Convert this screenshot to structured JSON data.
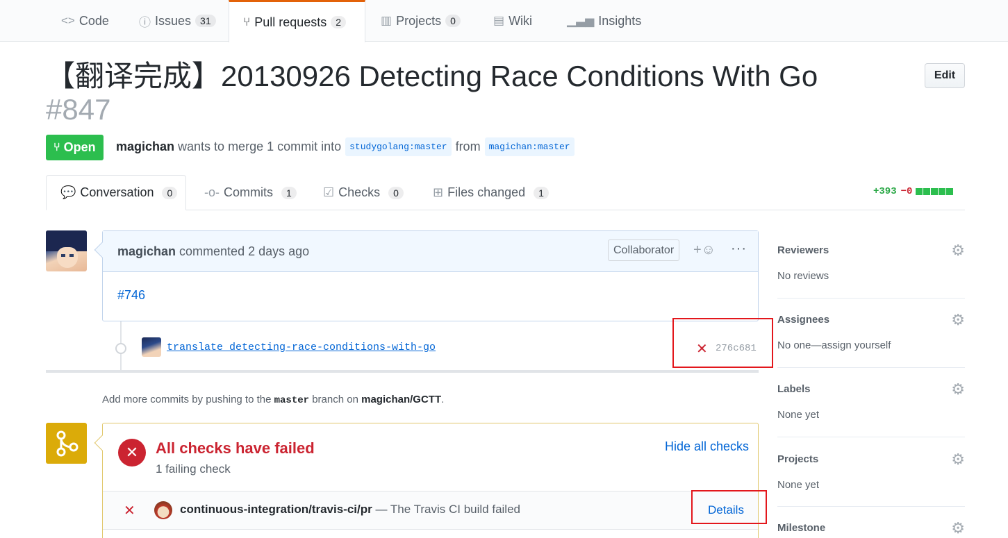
{
  "reponav": {
    "tabs": [
      {
        "label": "Code",
        "icon": "code-icon",
        "count": null
      },
      {
        "label": "Issues",
        "icon": "issue-icon",
        "count": "31"
      },
      {
        "label": "Pull requests",
        "icon": "pull-request-icon",
        "count": "2"
      },
      {
        "label": "Projects",
        "icon": "project-icon",
        "count": "0"
      },
      {
        "label": "Wiki",
        "icon": "book-icon",
        "count": null
      },
      {
        "label": "Insights",
        "icon": "graph-icon",
        "count": null
      }
    ],
    "selected": "Pull requests"
  },
  "pr": {
    "title": "【翻译完成】20130926 Detecting Race Conditions With Go",
    "number": "#847",
    "edit_label": "Edit",
    "state": "Open",
    "author": "magichan",
    "merge_text": "wants to merge 1 commit into",
    "base_branch": "studygolang:master",
    "from_text": "from",
    "head_branch": "magichan:master"
  },
  "prtabs": [
    {
      "label": "Conversation",
      "icon": "comment-discussion-icon",
      "count": "0"
    },
    {
      "label": "Commits",
      "icon": "commit-icon",
      "count": "1"
    },
    {
      "label": "Checks",
      "icon": "checklist-icon",
      "count": "0"
    },
    {
      "label": "Files changed",
      "icon": "file-diff-icon",
      "count": "1"
    }
  ],
  "diffstat": {
    "additions": "+393",
    "deletions": "−0"
  },
  "comment": {
    "author": "magichan",
    "action": "commented 2 days ago",
    "badge": "Collaborator",
    "body_link": "#746"
  },
  "commit": {
    "message": "translate detecting-race-conditions-with-go",
    "status": "✕",
    "sha": "276c681"
  },
  "addmore": {
    "prefix": "Add more commits by pushing to the",
    "branch": "master",
    "middle": "branch on",
    "repo": "magichan/GCTT",
    "suffix": "."
  },
  "checks": {
    "title": "All checks have failed",
    "subtitle": "1 failing check",
    "hide_label": "Hide all checks",
    "items": [
      {
        "name": "continuous-integration/travis-ci/pr",
        "desc": "— The Travis CI build failed",
        "link": "Details"
      }
    ]
  },
  "sidebar": {
    "reviewers": {
      "label": "Reviewers",
      "value": "No reviews"
    },
    "assignees": {
      "label": "Assignees",
      "value": "No one—assign yourself"
    },
    "labels": {
      "label": "Labels",
      "value": "None yet"
    },
    "projects": {
      "label": "Projects",
      "value": "None yet"
    },
    "milestone": {
      "label": "Milestone",
      "value": ""
    }
  },
  "colors": {
    "accent": "#0366d6",
    "success": "#2cbe4e",
    "danger": "#cb2431",
    "warning": "#dbab09",
    "tab_highlight": "#e36209"
  }
}
